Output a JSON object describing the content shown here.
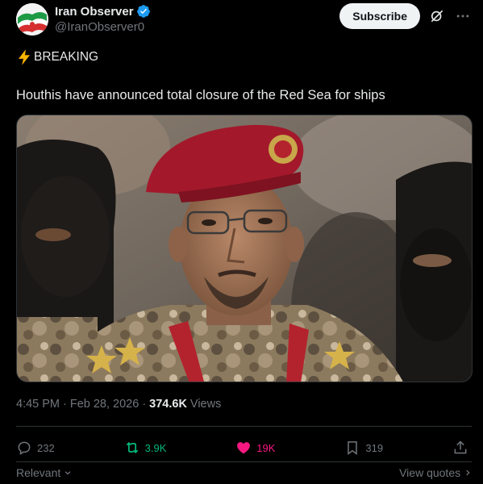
{
  "author": {
    "display_name": "Iran Observer",
    "handle": "@IranObserver0"
  },
  "header": {
    "subscribe_label": "Subscribe"
  },
  "tweet": {
    "tag_text": "BREAKING",
    "body": "Houthis have announced total closure of the Red Sea for ships"
  },
  "meta": {
    "time": "4:45 PM",
    "separator": "·",
    "date": "Feb 28, 2026",
    "views_count": "374.6K",
    "views_label": "Views"
  },
  "actions": {
    "replies": "232",
    "reposts": "3.9K",
    "likes": "19K",
    "bookmarks": "319"
  },
  "footer": {
    "relevant_label": "Relevant",
    "view_quotes_label": "View quotes"
  },
  "colors": {
    "background": "#000000",
    "text": "#e7e9ea",
    "muted": "#71767b",
    "repost": "#00ba7c",
    "like": "#f91880",
    "verified": "#1d9bf0"
  }
}
